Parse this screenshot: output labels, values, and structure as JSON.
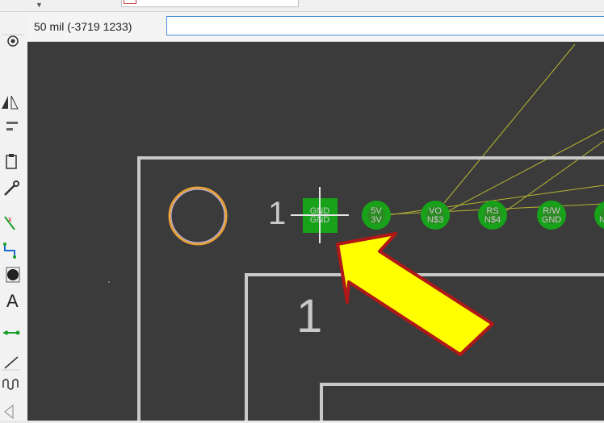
{
  "coordinate_readout": "50 mil (-3719 1233)",
  "command_input_value": "",
  "pins": [
    {
      "top": "GND",
      "bottom": "GND"
    },
    {
      "top": "5V",
      "bottom": "3V"
    },
    {
      "top": "VO",
      "bottom": "N$3"
    },
    {
      "top": "RS",
      "bottom": "N$4"
    },
    {
      "top": "R/W",
      "bottom": "GND"
    },
    {
      "top": "",
      "bottom": "N"
    }
  ],
  "pin1_label": "1",
  "part_label": "1",
  "colors": {
    "canvas": "#3b3b3b",
    "outline": "#c9c9c9",
    "pad_green": "#17a21a",
    "via_ring": "#e8a13a",
    "airwire": "#b7b531",
    "arrow_fill": "#ffff00",
    "arrow_stroke": "#b01818"
  },
  "toolbar_icons": [
    "eye-icon",
    "mirror-icon",
    "align-icon",
    "paste-icon",
    "wrench-icon",
    "ripup-icon",
    "route-icon",
    "circle-icon",
    "text-icon",
    "wire-icon",
    "line-icon",
    "meander-icon",
    "misc-icon"
  ]
}
